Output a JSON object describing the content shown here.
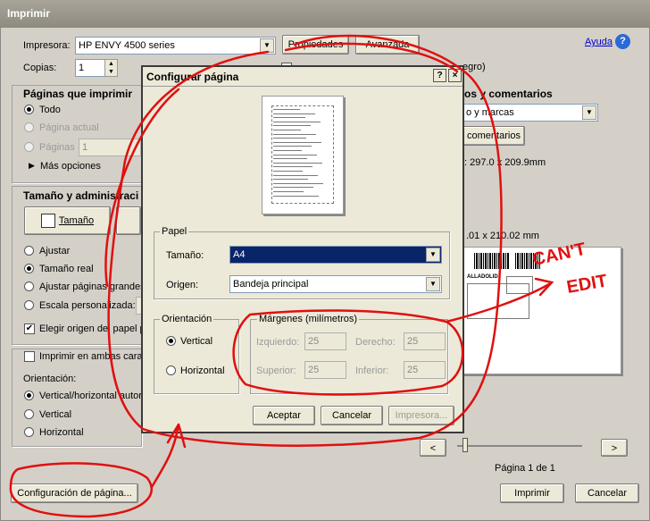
{
  "window": {
    "title": "Imprimir"
  },
  "printer": {
    "label": "Impresora:",
    "value": "HP ENVY 4500 series",
    "properties": "Propiedades",
    "advanced": "Avanzada",
    "help": "Ayuda"
  },
  "copies": {
    "label": "Copias:",
    "value": "1"
  },
  "background_text": {
    "gray_suffix": "egro)"
  },
  "pages": {
    "heading": "Páginas que imprimir",
    "all": "Todo",
    "current": "Página actual",
    "pages": "Páginas",
    "pages_value": "1",
    "more": "Más opciones"
  },
  "sizing": {
    "heading": "Tamaño y administraci",
    "size_button": "Tamaño",
    "fit": "Ajustar",
    "actual": "Tamaño real",
    "shrink": "Ajustar páginas grandes",
    "custom": "Escala personalizada:",
    "choose_source": "Elegir origen del papel p"
  },
  "duplex": {
    "label": "Imprimir en ambas caras"
  },
  "orientation": {
    "label": "Orientación:",
    "auto": "Vertical/horizontal autor",
    "portrait": "Vertical",
    "landscape": "Horizontal"
  },
  "comments": {
    "heading": "os y comentarios",
    "select_value": "o y marcas",
    "button": "comentarios"
  },
  "dimensions": {
    "doc": ": 297.0 x 209.9mm",
    "paper": ".01 x 210.02 mm"
  },
  "preview_page": {
    "label": "Página 1 de 1",
    "prev": "<",
    "next": ">",
    "sheet_text": "ALLADOLID"
  },
  "footer": {
    "page_setup": "Configuración de página...",
    "print": "Imprimir",
    "cancel": "Cancelar"
  },
  "dialog": {
    "title": "Configurar página",
    "help_btn": "?",
    "close_btn": "×",
    "paper_group": "Papel",
    "size_label": "Tamaño:",
    "size_value": "A4",
    "source_label": "Origen:",
    "source_value": "Bandeja principal",
    "orientation_group": "Orientación",
    "portrait": "Vertical",
    "landscape": "Horizontal",
    "margins_group": "Márgenes (milímetros)",
    "left_label": "Izquierdo:",
    "left_value": "25",
    "right_label": "Derecho:",
    "right_value": "25",
    "top_label": "Superior:",
    "top_value": "25",
    "bottom_label": "Inferior:",
    "bottom_value": "25",
    "ok": "Aceptar",
    "cancel": "Cancelar",
    "printer": "Impresora..."
  },
  "annotation": {
    "text_line1": "CAN'T",
    "text_line2": "EDIT",
    "ink_color": "#e01010"
  }
}
